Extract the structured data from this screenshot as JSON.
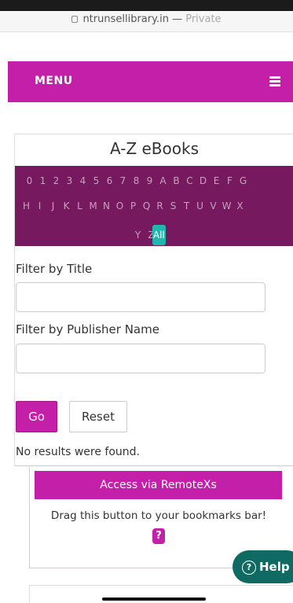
{
  "browser": {
    "domain": "ntrunsellibrary.in",
    "separator": "—",
    "mode": "Private"
  },
  "nav": {
    "menu_label": "MENU"
  },
  "ebooks": {
    "title": "A-Z eBooks",
    "row1": [
      "0",
      "1",
      "2",
      "3",
      "4",
      "5",
      "6",
      "7",
      "8",
      "9",
      "A",
      "B",
      "C",
      "D",
      "E",
      "F",
      "G"
    ],
    "row2": [
      "H",
      "I",
      "J",
      "K",
      "L",
      "M",
      "N",
      "O",
      "P",
      "Q",
      "R",
      "S",
      "T",
      "U",
      "V",
      "W",
      "X"
    ],
    "row3": [
      "Y",
      "Z"
    ],
    "all_label": "All"
  },
  "filters": {
    "title_label": "Filter by Title",
    "title_value": "",
    "publisher_label": "Filter by Publisher Name",
    "publisher_value": "",
    "go_label": "Go",
    "reset_label": "Reset",
    "no_results": "No results were found."
  },
  "remote": {
    "button_label": "Access via RemoteXs",
    "instruction": "Drag this button to your bookmarks bar!",
    "question_glyph": "?"
  },
  "help": {
    "label": "Help",
    "icon_glyph": "?"
  },
  "colors": {
    "brand_magenta": "#c41fa9",
    "alpha_bg": "#77195f",
    "active_teal": "#1fb8b0",
    "help_bg": "#0f6a64"
  }
}
